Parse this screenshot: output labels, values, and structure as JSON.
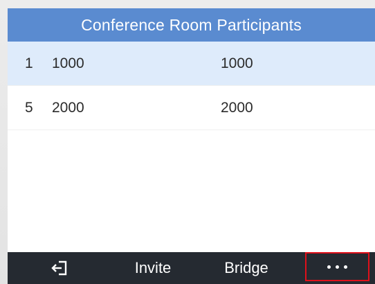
{
  "header": {
    "title": "Conference Room Participants"
  },
  "participants": [
    {
      "index": "1",
      "name": "1000",
      "number": "1000",
      "selected": true
    },
    {
      "index": "5",
      "name": "2000",
      "number": "2000",
      "selected": false
    }
  ],
  "softkeys": {
    "back_icon": "exit-arrow-icon",
    "invite_label": "Invite",
    "bridge_label": "Bridge",
    "more_icon": "more-dots-icon"
  },
  "colors": {
    "header_bg": "#5a8bd0",
    "selected_row_bg": "#deebfb",
    "softkey_bar_bg": "#252a31",
    "highlight_border": "#e0101a"
  }
}
